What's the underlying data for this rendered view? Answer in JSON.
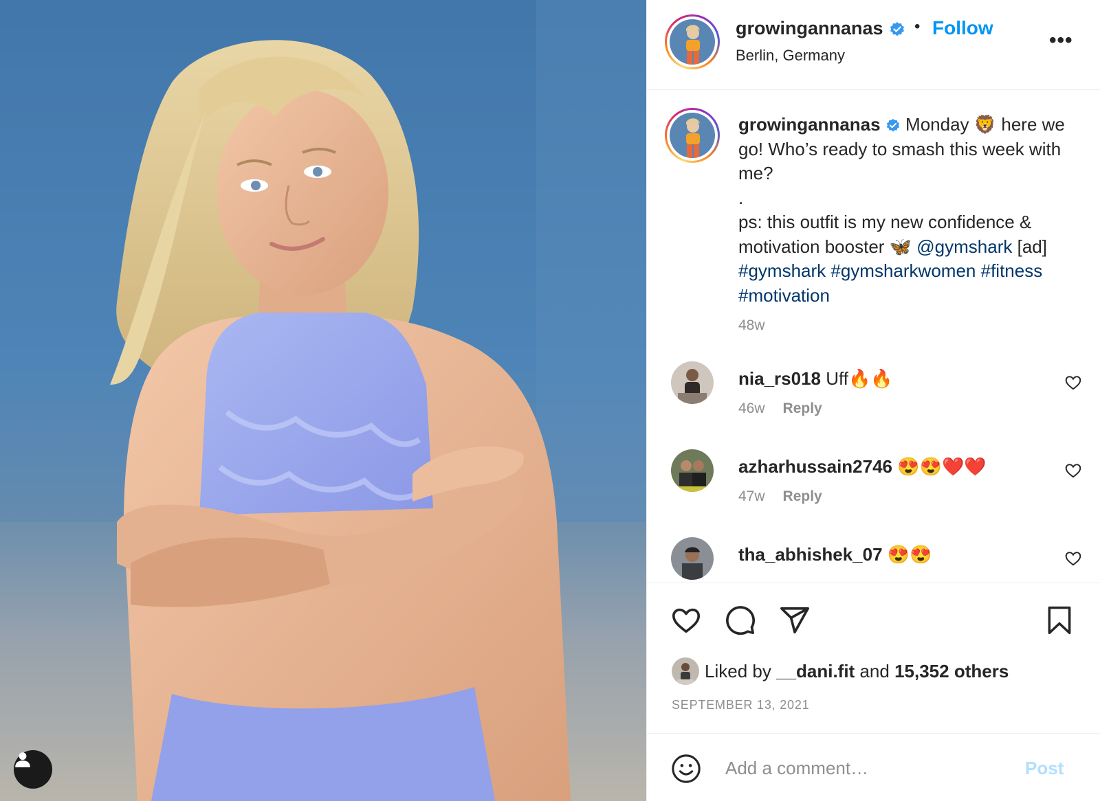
{
  "colors": {
    "accent": "#0095f6",
    "link": "#00376b",
    "muted": "#8e8e8e",
    "text": "#262626",
    "post_disabled": "#b2dffc"
  },
  "photo": {
    "tag_icon": "user-icon"
  },
  "header": {
    "username": "growingannanas",
    "verified": true,
    "separator": "•",
    "follow_label": "Follow",
    "location": "Berlin, Germany",
    "more_label": "•••"
  },
  "caption": {
    "username": "growingannanas",
    "line1": "Monday 🦁 here we go! Who’s ready to smash this week with me?",
    "line2": ".",
    "line3": "ps: this outfit is my new confidence & motivation booster 🦋",
    "mention": "@gymshark",
    "tag_ad": "[ad]",
    "hashtag1": "#gymshark",
    "hashtag2": "#gymsharkwomen",
    "hashtag3": "#fitness",
    "hashtag4": "#motivation",
    "time": "48w"
  },
  "comments": [
    {
      "username": "nia_rs018",
      "text": "Uff🔥🔥",
      "time": "46w",
      "reply": "Reply"
    },
    {
      "username": "azharhussain2746",
      "text": "😍😍❤️❤️",
      "time": "47w",
      "reply": "Reply"
    },
    {
      "username": "tha_abhishek_07",
      "text": "😍😍",
      "time": "",
      "reply": ""
    }
  ],
  "actions": {
    "like_icon": "heart-icon",
    "comment_icon": "comment-bubble-icon",
    "share_icon": "paper-plane-icon",
    "save_icon": "bookmark-icon"
  },
  "likes": {
    "prefix": "Liked by",
    "user": "__dani.fit",
    "middle": "and",
    "count": "15,352 others"
  },
  "date": "SEPTEMBER 13, 2021",
  "add_comment": {
    "placeholder": "Add a comment…",
    "post_label": "Post"
  }
}
